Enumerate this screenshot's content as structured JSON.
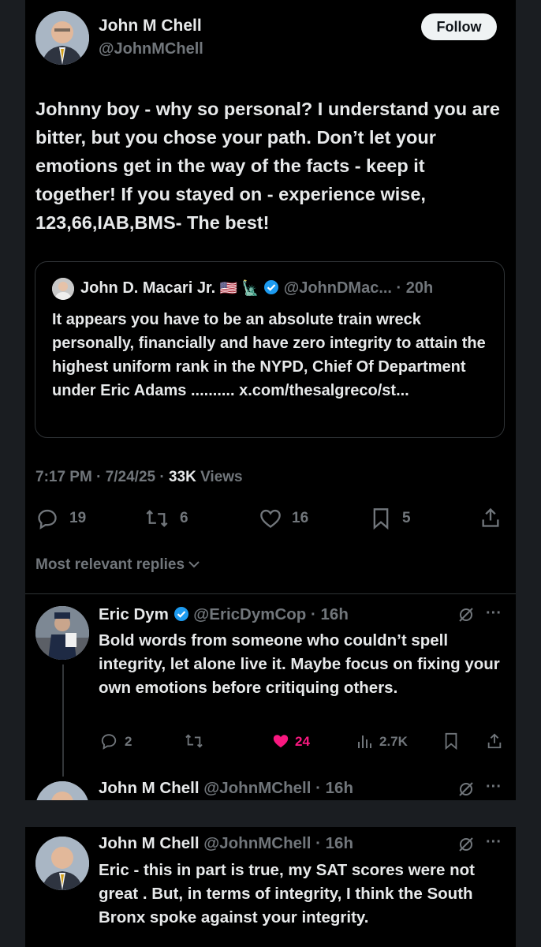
{
  "main_tweet": {
    "author_name": "John M Chell",
    "author_handle": "@JohnMChell",
    "follow_label": "Follow",
    "text": "Johnny boy - why so personal? I understand you are bitter, but you chose your path. Don’t let your emotions get in the way of the facts - keep it together! If you stayed on - experience wise, 123,66,IAB,BMS- The best!",
    "quote": {
      "author_name": "John D. Macari Jr.",
      "emoji": "🇺🇸 🗽",
      "handle_time": "@JohnDMac... · 20h",
      "text": "It appears you have to be an absolute train wreck personally, financially and have zero integrity to attain the highest uniform rank in the NYPD, Chief Of Department under Eric Adams .......... x.com/thesalgreco/st..."
    },
    "time": "7:17 PM · 7/24/25 · ",
    "views_count": "33K",
    "views_label": " Views",
    "replies": "19",
    "reposts": "6",
    "likes": "16",
    "bookmarks": "5"
  },
  "sort_label": "Most relevant replies",
  "replies": [
    {
      "author_name": "Eric Dym",
      "handle_time": "@EricDymCop · 16h",
      "text": "Bold words from someone who couldn’t spell integrity, let alone live it. Maybe focus on fixing your own emotions before critiquing others.",
      "replies": "2",
      "likes": "24",
      "views": "2.7K"
    },
    {
      "author_name": "John M Chell",
      "handle_time": "@JohnMChell · 16h"
    }
  ],
  "second_panel_reply": {
    "author_name": "John M Chell",
    "handle_time": "@JohnMChell · 16h",
    "text": "Eric - this in part is true, my SAT scores were not great . But, in terms of integrity, I think the South Bronx spoke against your integrity."
  },
  "colors": {
    "like_active": "#f91880",
    "verified": "#1d9bf0"
  }
}
